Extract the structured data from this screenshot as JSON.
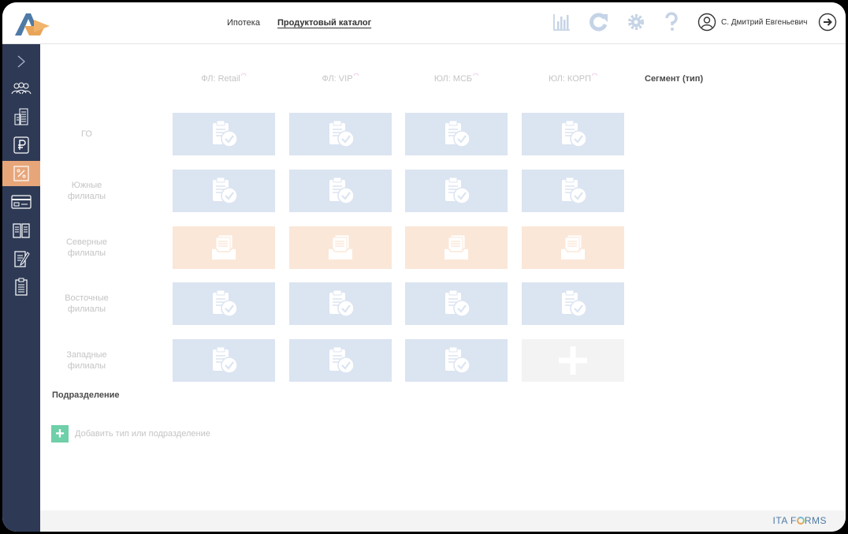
{
  "header": {
    "nav": [
      "Ипотека",
      "Продуктовый каталог"
    ],
    "active_nav": "Продуктовый каталог",
    "user_name": "С. Дмитрий Евгеньевич",
    "icons": [
      "chart-icon",
      "refresh-icon",
      "gear-icon",
      "help-icon",
      "user-icon",
      "logout-icon"
    ]
  },
  "sidebar": {
    "items": [
      "expand-icon",
      "users-icon",
      "buildings-icon",
      "ruble-icon",
      "percent-icon",
      "card-icon",
      "book-icon",
      "edit-doc-icon",
      "clipboard-icon"
    ],
    "active_index": 4,
    "active_color": "#e7a67a"
  },
  "grid": {
    "segment_label": "Сегмент (тип)",
    "division_label": "Подразделение",
    "columns": [
      "ФЛ: Retail",
      "ФЛ: VIP",
      "ЮЛ: МСБ",
      "ЮЛ: КОРП"
    ],
    "rows": [
      {
        "label": "ГО",
        "cells": [
          "blue",
          "blue",
          "blue",
          "blue"
        ]
      },
      {
        "label": "Южные филиалы",
        "cells": [
          "blue",
          "blue",
          "blue",
          "blue"
        ]
      },
      {
        "label": "Северные филиалы",
        "cells": [
          "orange",
          "orange",
          "orange",
          "orange"
        ]
      },
      {
        "label": "Восточные филиалы",
        "cells": [
          "blue",
          "blue",
          "blue",
          "blue"
        ]
      },
      {
        "label": "Западные филиалы",
        "cells": [
          "blue",
          "blue",
          "blue",
          "empty"
        ]
      }
    ],
    "add_label": "Добавить тип или подразделение"
  },
  "footer": {
    "brand_left": "ITA F",
    "brand_right": "RMS"
  }
}
